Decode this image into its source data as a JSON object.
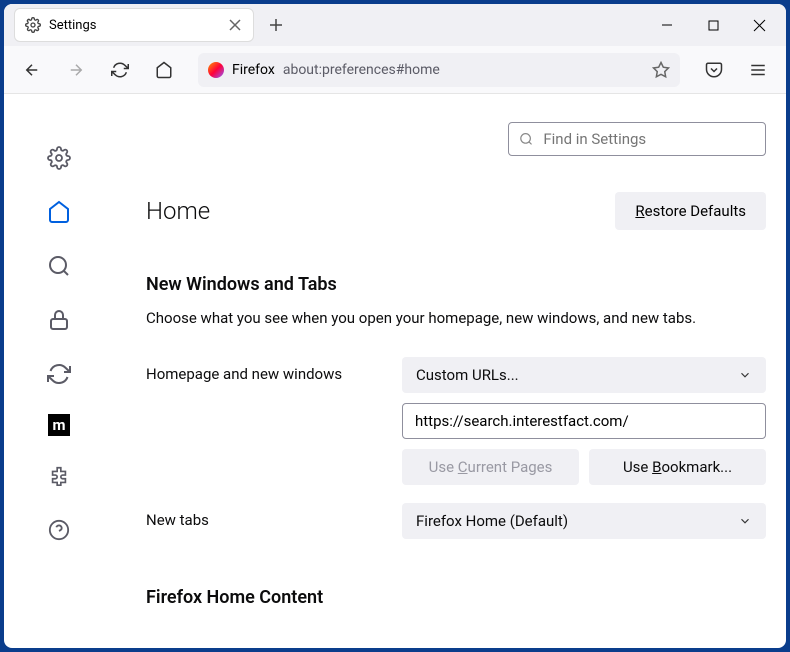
{
  "tab": {
    "title": "Settings"
  },
  "urlbar": {
    "label": "Firefox",
    "url": "about:preferences#home"
  },
  "search": {
    "placeholder": "Find in Settings"
  },
  "page": {
    "title": "Home",
    "restore": "Restore Defaults",
    "section_title": "New Windows and Tabs",
    "section_desc": "Choose what you see when you open your homepage, new windows, and new tabs.",
    "homepage_label": "Homepage and new windows",
    "homepage_dropdown": "Custom URLs...",
    "homepage_value": "https://search.interestfact.com/",
    "use_current": "Use Current Pages",
    "use_bookmark": "Use Bookmark...",
    "newtabs_label": "New tabs",
    "newtabs_dropdown": "Firefox Home (Default)",
    "content_title": "Firefox Home Content"
  }
}
